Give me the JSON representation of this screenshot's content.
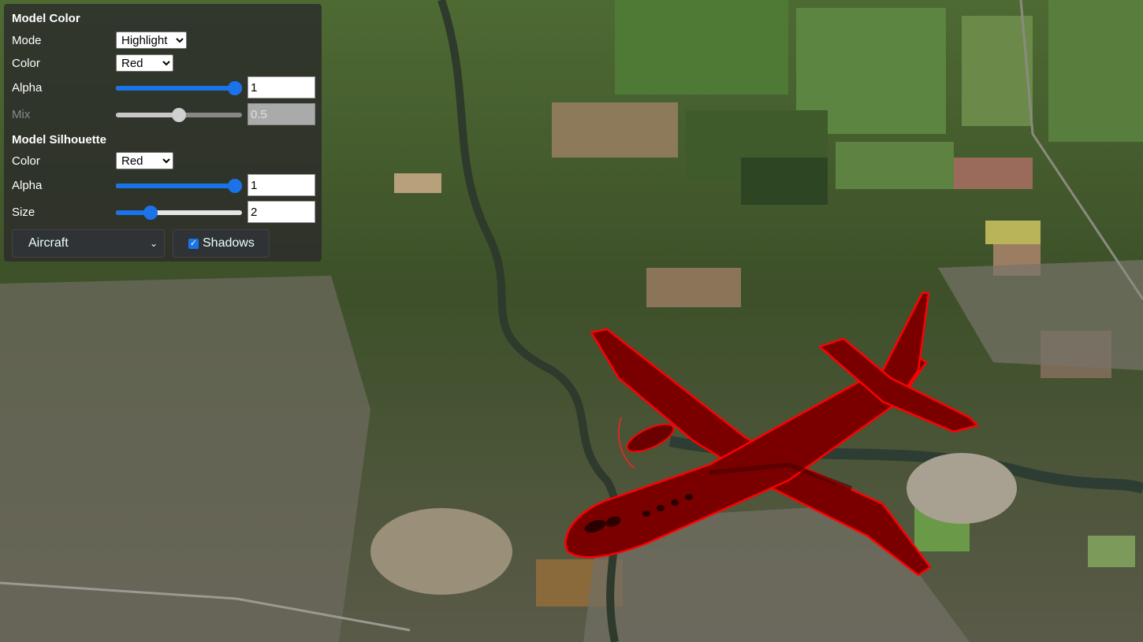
{
  "toolbar": {
    "model_color": {
      "title": "Model Color",
      "mode_label": "Mode",
      "mode_value": "Highlight",
      "color_label": "Color",
      "color_value": "Red",
      "alpha_label": "Alpha",
      "alpha_value": "1",
      "alpha_fraction": 1.0,
      "mix_label": "Mix",
      "mix_value": "0.5",
      "mix_fraction": 0.5
    },
    "model_silhouette": {
      "title": "Model Silhouette",
      "color_label": "Color",
      "color_value": "Red",
      "alpha_label": "Alpha",
      "alpha_value": "1",
      "alpha_fraction": 1.0,
      "size_label": "Size",
      "size_value": "2",
      "size_fraction": 0.25
    },
    "model_select_value": "Aircraft",
    "shadows_label": "Shadows",
    "shadows_checked": true
  },
  "icons": {
    "dropdown": "chevron-down-icon",
    "check": "checkmark-icon"
  },
  "colors": {
    "model_highlight": "#7a0000",
    "silhouette": "#ff0000",
    "slider_accent": "#1a73e8"
  }
}
